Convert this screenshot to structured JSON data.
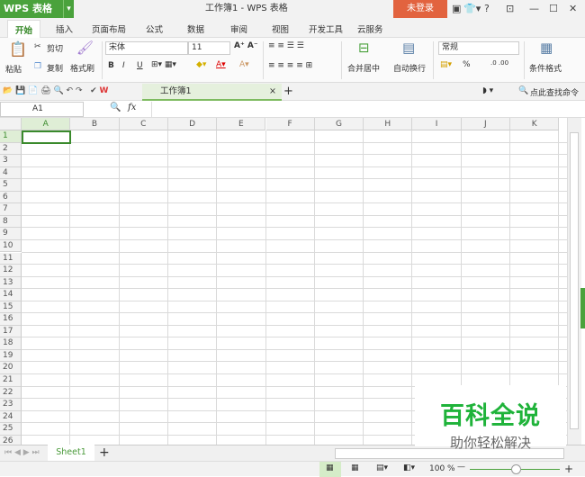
{
  "titlebar": {
    "app": "WPS 表格",
    "title": "工作簿1 - WPS 表格",
    "login": "未登录",
    "help": "?"
  },
  "tabs": [
    "开始",
    "插入",
    "页面布局",
    "公式",
    "数据",
    "审阅",
    "视图",
    "开发工具",
    "云服务"
  ],
  "ribbon": {
    "paste": "粘贴",
    "cut": "剪切",
    "copy": "复制",
    "format_painter": "格式刷",
    "font": "宋体",
    "size": "11",
    "bold": "B",
    "italic": "I",
    "underline": "U",
    "merge": "合并居中",
    "wrap": "自动换行",
    "number_format": "常规",
    "percent": "%",
    "cond_format": "条件格式"
  },
  "doc": {
    "tab": "工作簿1",
    "search": "点此查找命令"
  },
  "formula": {
    "namebox": "A1",
    "fx": "fx"
  },
  "columns": [
    "A",
    "B",
    "C",
    "D",
    "E",
    "F",
    "G",
    "H",
    "I",
    "J",
    "K"
  ],
  "row_count": 26,
  "sheets": [
    "Sheet1"
  ],
  "status": {
    "zoom": "100 %"
  },
  "watermark": {
    "title": "百科全说",
    "subtitle": "助你轻松解决"
  },
  "colors": {
    "accent": "#4aa23c",
    "login": "#e2633f"
  }
}
